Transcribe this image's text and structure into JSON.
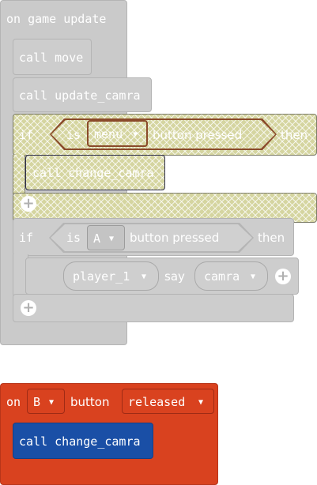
{
  "game_update_block": {
    "header": "on game update",
    "call_move": "call move",
    "call_update_camra": "call update_camra",
    "if_menu": {
      "if_label": "if",
      "is_label": "is",
      "button_value": "menu",
      "pressed_label": "button pressed",
      "then_label": "then",
      "body_call": "call change_camra"
    },
    "if_a": {
      "if_label": "if",
      "is_label": "is",
      "button_value": "A",
      "pressed_label": "button pressed",
      "then_label": "then",
      "sprite": "player_1",
      "say_label": "say",
      "say_value": "camra"
    }
  },
  "b_button_block": {
    "on_label": "on",
    "button_value": "B",
    "button_label": "button",
    "event_value": "released",
    "body_call": "call change_camra"
  },
  "caret": "▼",
  "icons": {
    "dropdown": "caret-down-icon",
    "add": "plus-circle-icon"
  },
  "colors": {
    "disabled_grey": "#cacaca",
    "event_red": "#d9421f",
    "function_blue": "#1a4fa6",
    "highlight": "#d5d5a0"
  }
}
